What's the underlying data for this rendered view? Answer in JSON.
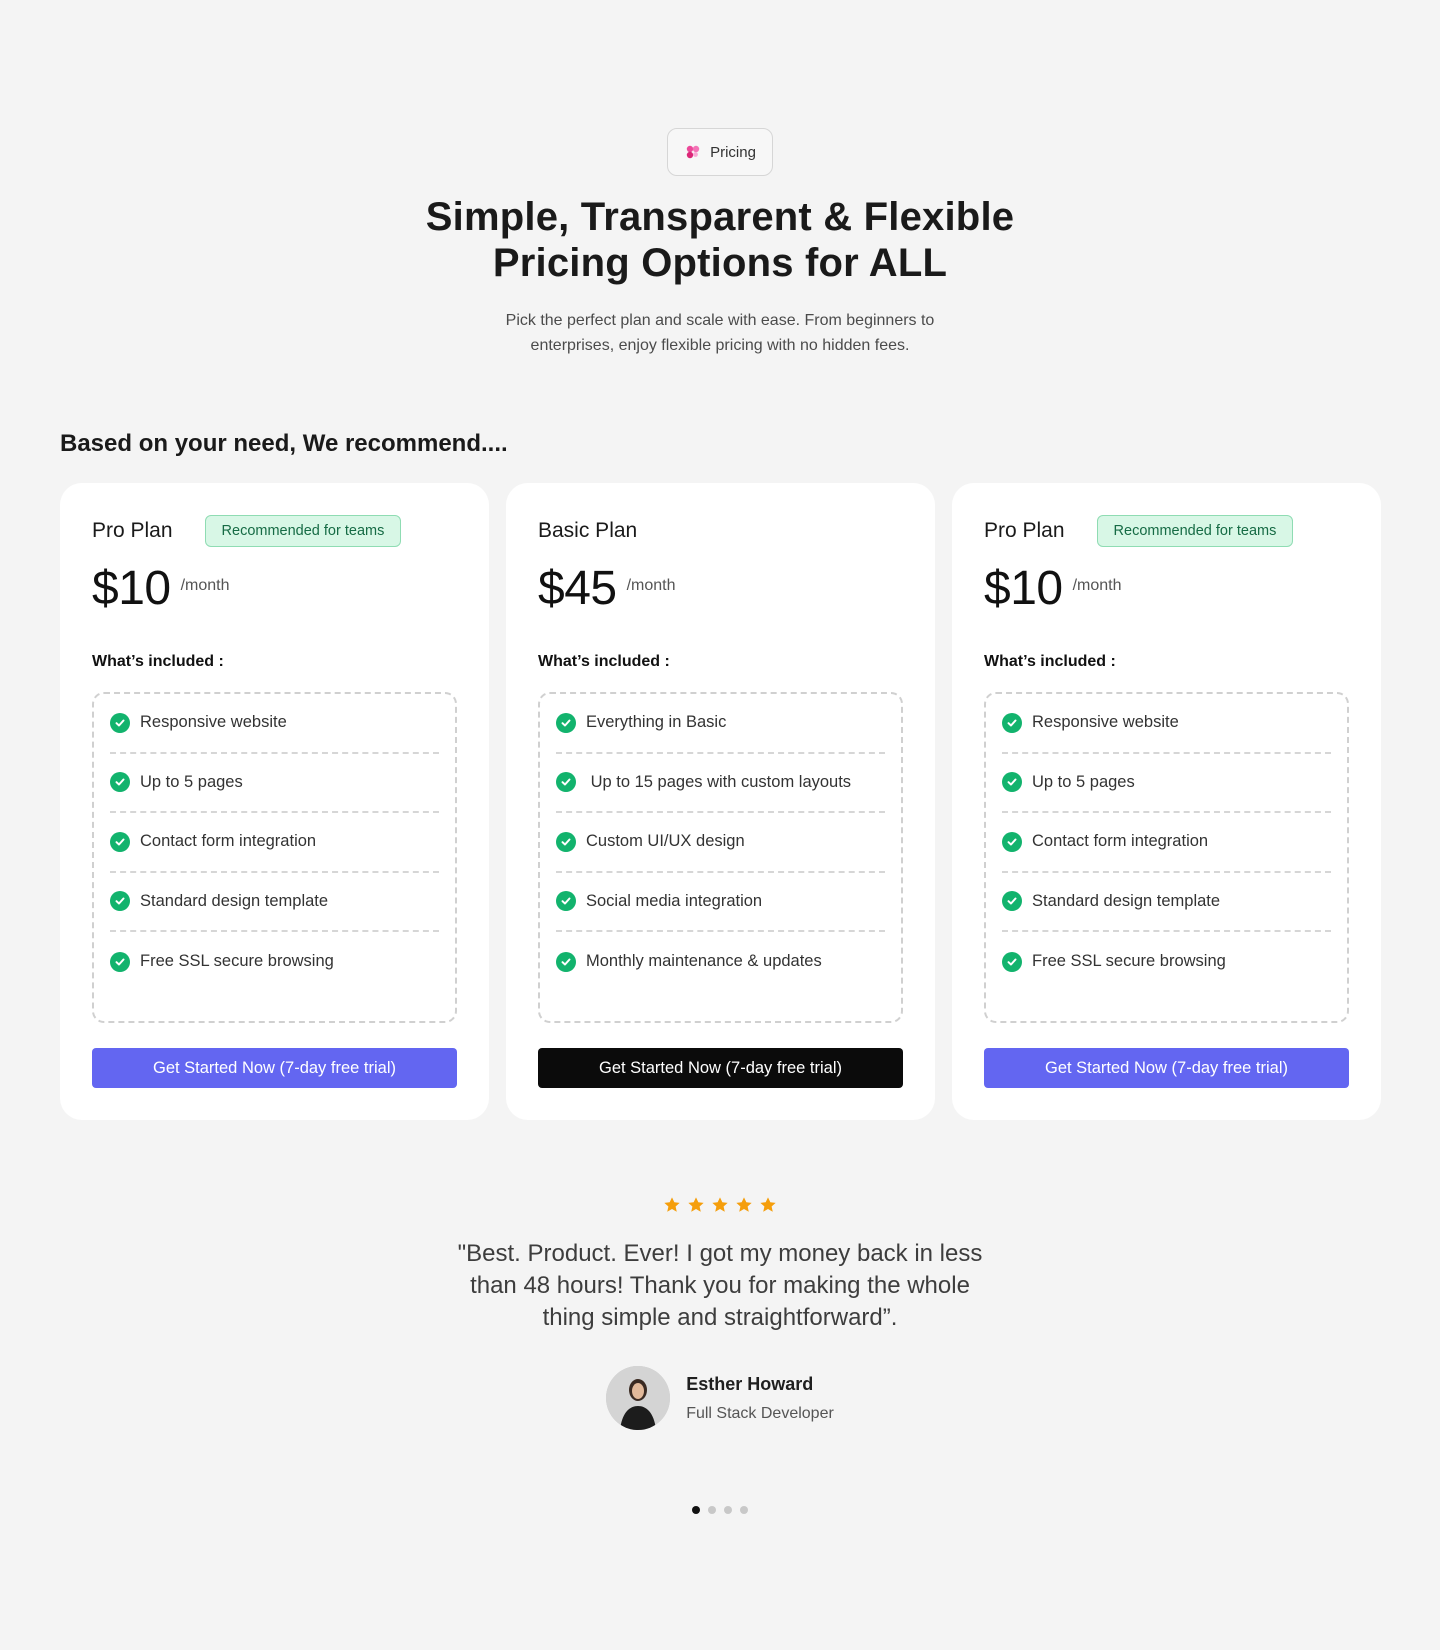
{
  "hero": {
    "badge_label": "Pricing",
    "badge_icon": "flower-icon",
    "title": "Simple, Transparent & Flexible Pricing Options for ALL",
    "subtitle": "Pick the perfect plan and scale with ease. From beginners to enterprises, enjoy flexible pricing with no hidden fees."
  },
  "recommend_heading": "Based on your need, We recommend....",
  "plans": [
    {
      "name": "Pro Plan",
      "tag": "Recommended for teams",
      "price": "$10",
      "period": "/month",
      "included_label": "What’s included :",
      "features": [
        "Responsive website",
        "Up to 5 pages",
        "Contact form integration",
        "Standard design template",
        "Free SSL secure browsing"
      ],
      "cta": "Get Started Now (7-day free trial)",
      "cta_style": "primary"
    },
    {
      "name": "Basic Plan",
      "tag": "",
      "price": "$45",
      "period": "/month",
      "included_label": "What’s included :",
      "features": [
        "Everything in Basic",
        " Up to 15 pages with custom layouts",
        "Custom UI/UX design",
        "Social media integration",
        "Monthly maintenance & updates"
      ],
      "cta": "Get Started Now (7-day free trial)",
      "cta_style": "dark"
    },
    {
      "name": "Pro Plan",
      "tag": "Recommended for teams",
      "price": "$10",
      "period": "/month",
      "included_label": "What’s included :",
      "features": [
        "Responsive website",
        "Up to 5 pages",
        "Contact form integration",
        "Standard design template",
        "Free SSL secure browsing"
      ],
      "cta": "Get Started Now (7-day free trial)",
      "cta_style": "primary"
    }
  ],
  "testimonial": {
    "rating": 5,
    "quote": "\"Best. Product. Ever! I got my money back in less than 48 hours! Thank you for making the whole thing simple and straightforward”.",
    "author_name": "Esther Howard",
    "author_role": "Full Stack Developer"
  },
  "carousel": {
    "total": 4,
    "active_index": 0
  },
  "colors": {
    "primary": "#6366f1",
    "dark": "#0b0b0b",
    "check": "#12b36d",
    "star": "#f59e0b",
    "tag_bg": "#d8f7e6"
  }
}
